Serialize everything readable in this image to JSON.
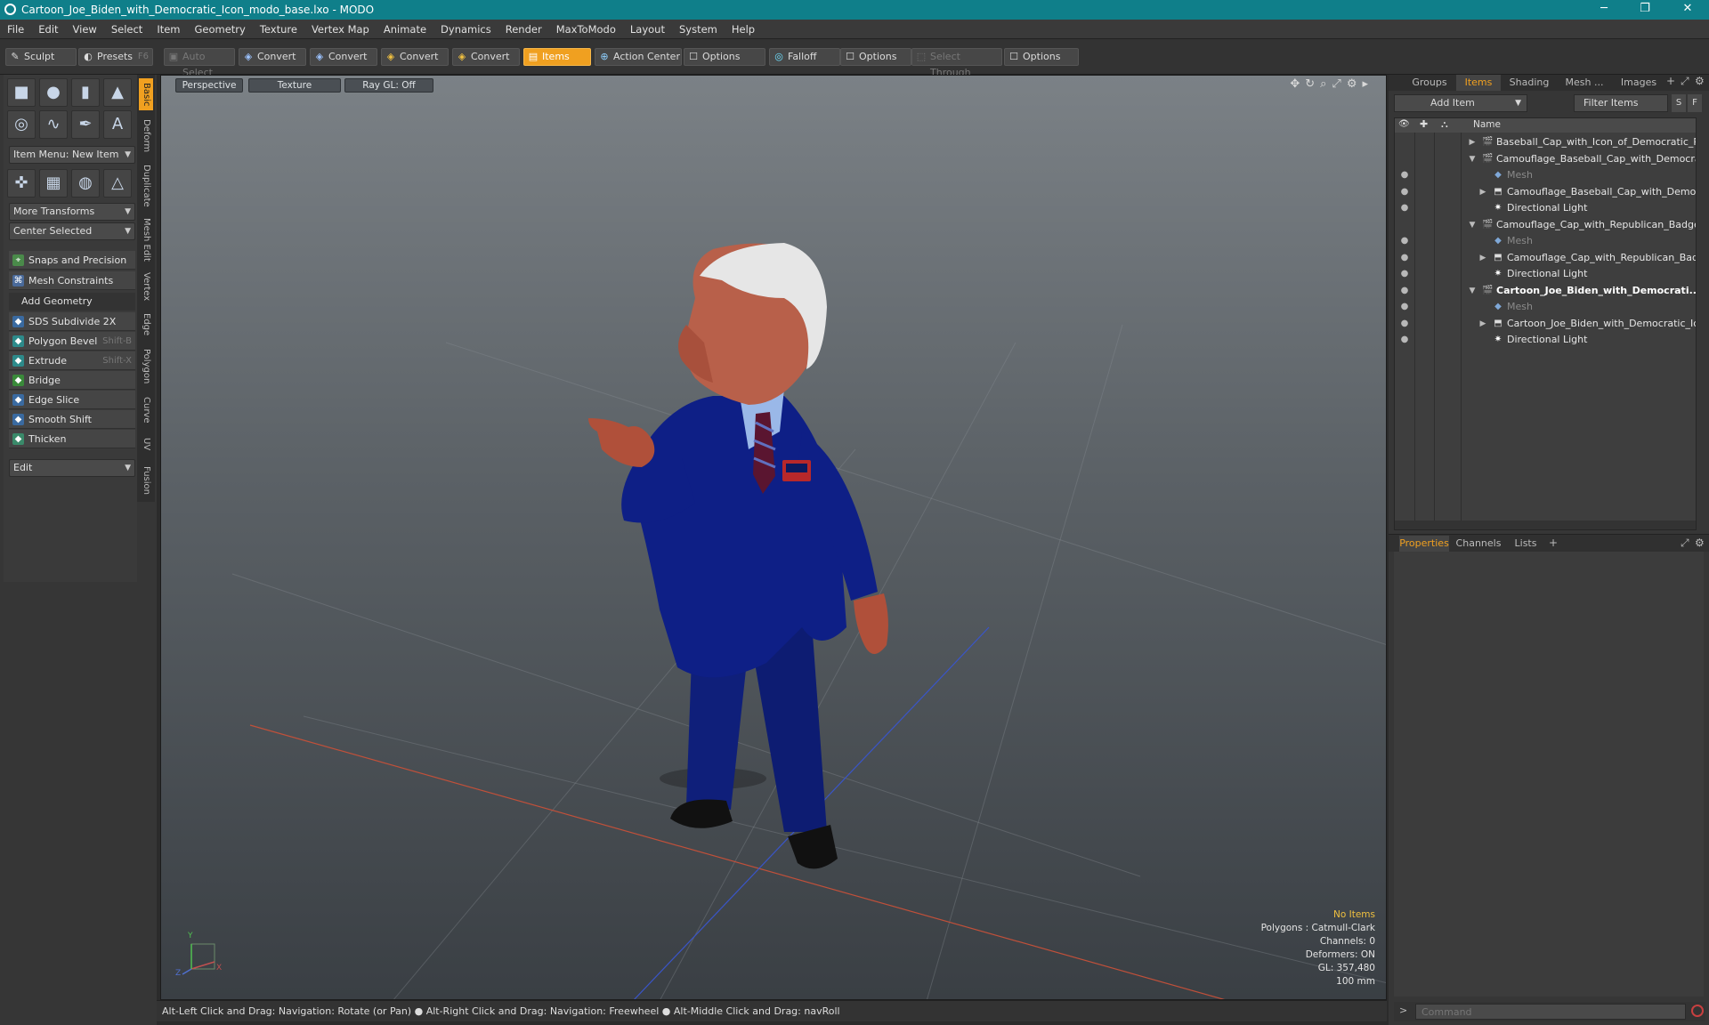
{
  "window": {
    "title": "Cartoon_Joe_Biden_with_Democratic_Icon_modo_base.lxo - MODO",
    "minimize": "─",
    "restore": "❐",
    "close": "✕"
  },
  "menu": [
    "File",
    "Edit",
    "View",
    "Select",
    "Item",
    "Geometry",
    "Texture",
    "Vertex Map",
    "Animate",
    "Dynamics",
    "Render",
    "MaxToModo",
    "Layout",
    "System",
    "Help"
  ],
  "toolbar": {
    "sculpt": "Sculpt",
    "presets": "Presets",
    "presets_shortcut": "F6",
    "auto_select": "Auto Select",
    "convert": "Convert",
    "items": "Items",
    "action_center": "Action Center",
    "options": "Options",
    "falloff": "Falloff",
    "select_through": "Select Through"
  },
  "left": {
    "item_menu": "Item Menu: New Item",
    "more_transforms": "More Transforms",
    "center_selected": "Center Selected",
    "snaps": "Snaps and Precision",
    "mesh_constraints": "Mesh Constraints",
    "add_geometry": "Add Geometry",
    "tools": [
      {
        "label": "SDS Subdivide 2X",
        "shortcut": ""
      },
      {
        "label": "Polygon Bevel",
        "shortcut": "Shift-B"
      },
      {
        "label": "Extrude",
        "shortcut": "Shift-X"
      },
      {
        "label": "Bridge",
        "shortcut": ""
      },
      {
        "label": "Edge Slice",
        "shortcut": ""
      },
      {
        "label": "Smooth Shift",
        "shortcut": ""
      },
      {
        "label": "Thicken",
        "shortcut": ""
      }
    ],
    "edit": "Edit",
    "vtabs": [
      "Basic",
      "Deform",
      "Duplicate",
      "Mesh Edit",
      "Vertex",
      "Edge",
      "Polygon",
      "Curve",
      "UV",
      "Fusion"
    ]
  },
  "viewport": {
    "view": "Perspective",
    "shading": "Texture",
    "raygl": "Ray GL: Off",
    "stats": {
      "selection": "No Items",
      "polygons": "Polygons : Catmull-Clark",
      "channels": "Channels: 0",
      "deformers": "Deformers: ON",
      "gl": "GL: 357,480",
      "grid": "100 mm"
    },
    "axis_x": "X",
    "axis_y": "Y",
    "axis_z": "Z"
  },
  "status": "Alt-Left Click and Drag: Navigation: Rotate (or Pan) ● Alt-Right Click and Drag: Navigation: Freewheel ● Alt-Middle Click and Drag: navRoll",
  "right": {
    "tabs": [
      "Groups",
      "Items",
      "Shading",
      "Mesh ...",
      "Images"
    ],
    "add_item": "Add Item",
    "filter_items": "Filter Items",
    "filter_s": "S",
    "filter_f": "F",
    "col_name": "Name",
    "tree": [
      {
        "label": "Baseball_Cap_with_Icon_of_Democratic_P ...",
        "level": 0,
        "type": "scene",
        "expanded": false,
        "eye": false,
        "style": "normal"
      },
      {
        "label": "Camouflage_Baseball_Cap_with_Democrati...",
        "level": 0,
        "type": "scene",
        "expanded": true,
        "eye": false,
        "style": "normal"
      },
      {
        "label": "Mesh",
        "level": 1,
        "type": "mesh",
        "expanded": null,
        "eye": true,
        "style": "dim"
      },
      {
        "label": "Camouflage_Baseball_Cap_with_Democr...",
        "level": 1,
        "type": "group",
        "expanded": false,
        "eye": true,
        "style": "normal"
      },
      {
        "label": "Directional Light",
        "level": 1,
        "type": "light",
        "expanded": null,
        "eye": true,
        "style": "normal"
      },
      {
        "label": "Camouflage_Cap_with_Republican_Badge ...",
        "level": 0,
        "type": "scene",
        "expanded": true,
        "eye": false,
        "style": "normal"
      },
      {
        "label": "Mesh",
        "level": 1,
        "type": "mesh",
        "expanded": null,
        "eye": true,
        "style": "dim"
      },
      {
        "label": "Camouflage_Cap_with_Republican_Badge",
        "level": 1,
        "type": "group",
        "expanded": false,
        "eye": true,
        "style": "normal"
      },
      {
        "label": "Directional Light",
        "level": 1,
        "type": "light",
        "expanded": null,
        "eye": true,
        "style": "normal"
      },
      {
        "label": "Cartoon_Joe_Biden_with_Democrati...",
        "level": 0,
        "type": "scene",
        "expanded": true,
        "eye": true,
        "style": "bold"
      },
      {
        "label": "Mesh",
        "level": 1,
        "type": "mesh",
        "expanded": null,
        "eye": true,
        "style": "dim"
      },
      {
        "label": "Cartoon_Joe_Biden_with_Democratic_Icon",
        "level": 1,
        "type": "group",
        "expanded": false,
        "eye": true,
        "style": "normal"
      },
      {
        "label": "Directional Light",
        "level": 1,
        "type": "light",
        "expanded": null,
        "eye": true,
        "style": "normal"
      }
    ],
    "prop_tabs": [
      "Properties",
      "Channels",
      "Lists"
    ],
    "command_placeholder": "Command"
  },
  "colors": {
    "accent": "#f0a020",
    "titlebar": "#0f7f8a",
    "suit": "#0e1f86"
  }
}
